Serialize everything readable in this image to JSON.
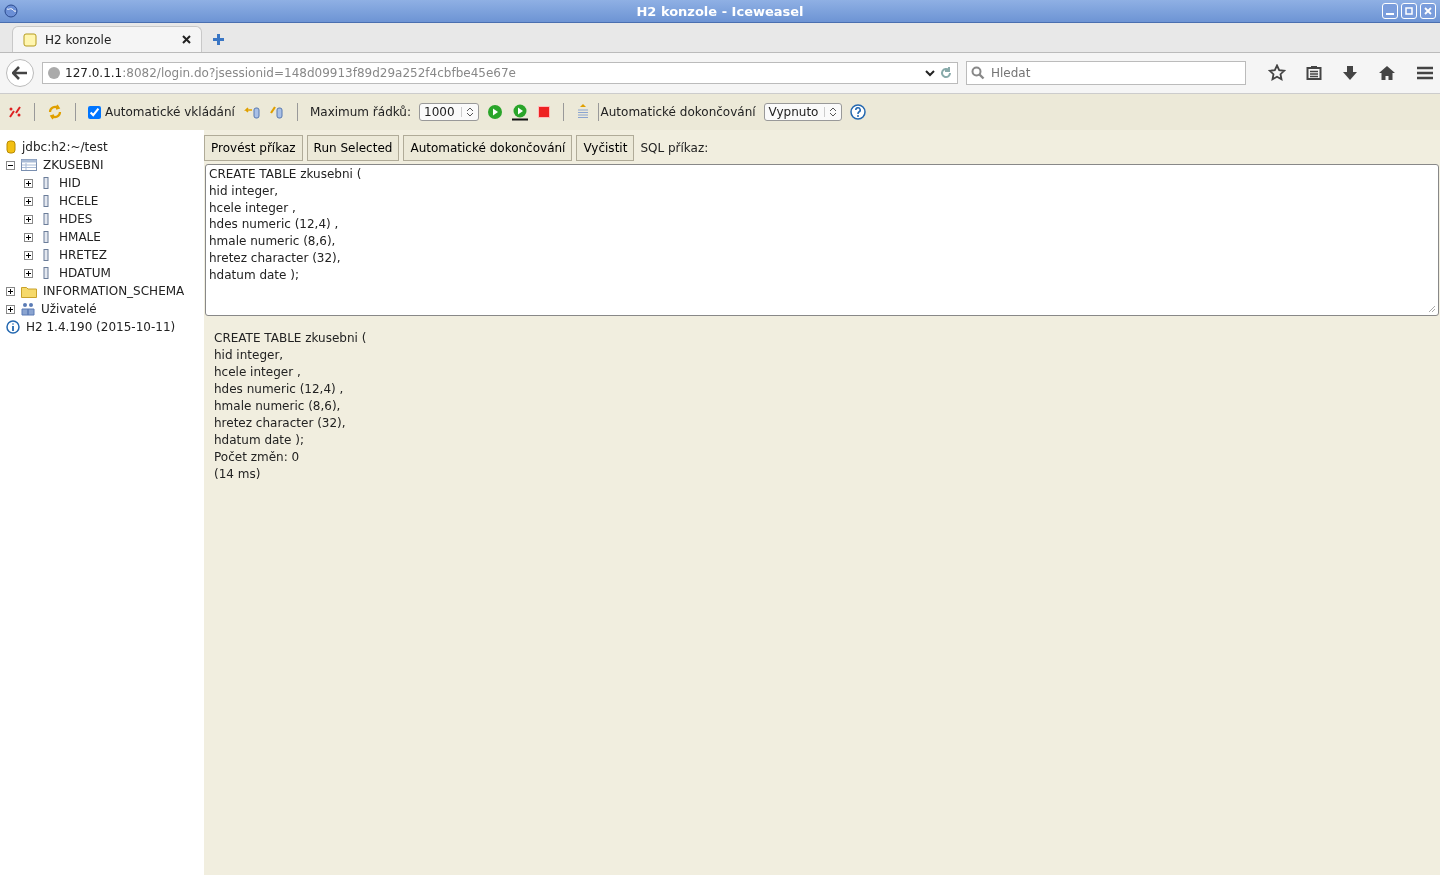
{
  "window": {
    "title": "H2 konzole - Iceweasel"
  },
  "tabs": [
    {
      "label": "H2 konzole",
      "selected": true
    }
  ],
  "address": {
    "host": "127.0.1.1",
    "rest": ":8082/login.do?jsessionid=148d09913f89d29a252f4cbfbe45e67e"
  },
  "search": {
    "placeholder": "Hledat"
  },
  "toolbar": {
    "auto_commit": {
      "label": "Automatické vkládání",
      "checked": true
    },
    "max_rows": {
      "label": "Maximum řádků:",
      "value": "1000"
    },
    "autocomplete": {
      "label": "Automatické dokončování",
      "value": "Vypnuto"
    }
  },
  "buttons": [
    "Provést příkaz",
    "Run Selected",
    "Automatické dokončování",
    "Vyčistit"
  ],
  "sql_label": "SQL příkaz:",
  "editor_lines": [
    "CREATE TABLE zkusebni (",
    "hid integer,",
    "hcele integer ,",
    "hdes numeric (12,4) ,",
    "hmale numeric (8,6),",
    "hretez character (32),",
    "hdatum date );"
  ],
  "tree": [
    {
      "kind": "database",
      "label": "jdbc:h2:~/test"
    },
    {
      "kind": "table",
      "label": "ZKUSEBNI",
      "expanded": true,
      "children": [
        {
          "kind": "column",
          "label": "HID",
          "expanded": false
        },
        {
          "kind": "column",
          "label": "HCELE",
          "expanded": false
        },
        {
          "kind": "column",
          "label": "HDES",
          "expanded": false
        },
        {
          "kind": "column",
          "label": "HMALE",
          "expanded": false
        },
        {
          "kind": "column",
          "label": "HRETEZ",
          "expanded": false
        },
        {
          "kind": "column",
          "label": "HDATUM",
          "expanded": false
        }
      ]
    },
    {
      "kind": "folder",
      "label": "INFORMATION_SCHEMA",
      "expanded": false
    },
    {
      "kind": "users",
      "label": "Uživatelé",
      "expanded": false
    },
    {
      "kind": "info",
      "label": "H2 1.4.190 (2015-10-11)"
    }
  ],
  "result_lines": [
    "CREATE TABLE zkusebni (",
    "hid integer,",
    "hcele integer ,",
    "hdes numeric (12,4) ,",
    "hmale numeric (8,6),",
    "hretez character (32),",
    "hdatum date );",
    "Počet změn: 0",
    "(14 ms)"
  ]
}
